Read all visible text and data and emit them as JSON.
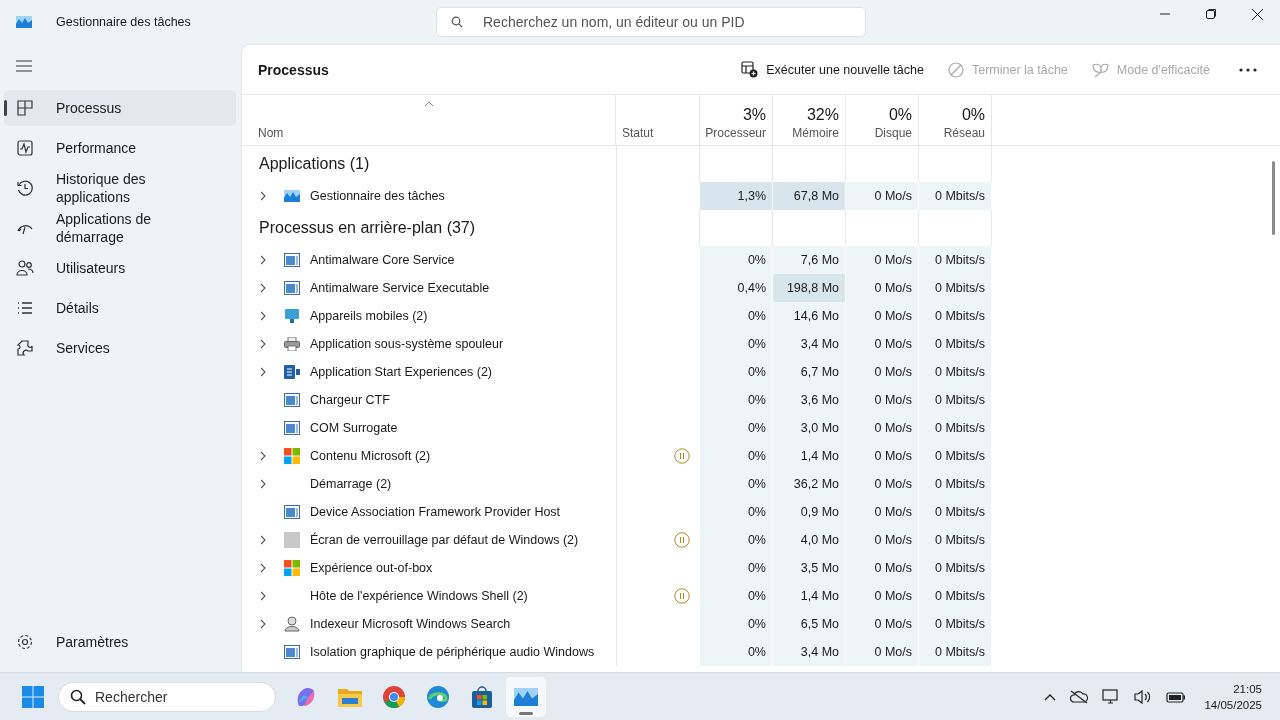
{
  "window": {
    "title": "Gestionnaire des tâches"
  },
  "search": {
    "placeholder": "Recherchez un nom, un éditeur ou un PID"
  },
  "sidebar": {
    "items": [
      {
        "label": "Processus",
        "selected": true
      },
      {
        "label": "Performance",
        "selected": false
      },
      {
        "label": "Historique des applications",
        "selected": false
      },
      {
        "label": "Applications de démarrage",
        "selected": false
      },
      {
        "label": "Utilisateurs",
        "selected": false
      },
      {
        "label": "Détails",
        "selected": false
      },
      {
        "label": "Services",
        "selected": false
      }
    ],
    "footer": {
      "label": "Paramètres"
    }
  },
  "page": {
    "title": "Processus",
    "actions": [
      {
        "label": "Exécuter une nouvelle tâche",
        "disabled": false
      },
      {
        "label": "Terminer la tâche",
        "disabled": true
      },
      {
        "label": "Mode d'efficacité",
        "disabled": true
      }
    ]
  },
  "table": {
    "columns": [
      {
        "label": "Nom",
        "sorted": true
      },
      {
        "label": "Statut",
        "sorted": false
      },
      {
        "label": "Processeur",
        "usage": "3%",
        "sorted": false
      },
      {
        "label": "Mémoire",
        "usage": "32%",
        "sorted": false
      },
      {
        "label": "Disque",
        "usage": "0%",
        "sorted": false
      },
      {
        "label": "Réseau",
        "usage": "0%",
        "sorted": false
      }
    ],
    "groups": [
      {
        "title": "Applications (1)",
        "rows": [
          {
            "name": "Gestionnaire des tâches",
            "kind": "taskmgr",
            "expandable": true,
            "suspended": false,
            "cpu": "1,3%",
            "memory": "67,8 Mo",
            "disk": "0 Mo/s",
            "network": "0 Mbits/s",
            "cpu_hot": true,
            "memory_hot": true
          }
        ]
      },
      {
        "title": "Processus en arrière-plan (37)",
        "rows": [
          {
            "name": "Antimalware Core Service",
            "kind": "service",
            "expandable": true,
            "suspended": false,
            "cpu": "0%",
            "memory": "7,6 Mo",
            "disk": "0 Mo/s",
            "network": "0 Mbits/s",
            "cpu_hot": false,
            "memory_hot": false
          },
          {
            "name": "Antimalware Service Executable",
            "kind": "service",
            "expandable": true,
            "suspended": false,
            "cpu": "0,4%",
            "memory": "198,8 Mo",
            "disk": "0 Mo/s",
            "network": "0 Mbits/s",
            "cpu_hot": false,
            "memory_hot": true
          },
          {
            "name": "Appareils mobiles (2)",
            "kind": "mobile",
            "expandable": true,
            "suspended": false,
            "cpu": "0%",
            "memory": "14,6 Mo",
            "disk": "0 Mo/s",
            "network": "0 Mbits/s",
            "cpu_hot": false,
            "memory_hot": false
          },
          {
            "name": "Application sous-système spouleur",
            "kind": "printer",
            "expandable": true,
            "suspended": false,
            "cpu": "0%",
            "memory": "3,4 Mo",
            "disk": "0 Mo/s",
            "network": "0 Mbits/s",
            "cpu_hot": false,
            "memory_hot": false
          },
          {
            "name": "Application Start Experiences (2)",
            "kind": "appstart",
            "expandable": true,
            "suspended": false,
            "cpu": "0%",
            "memory": "6,7 Mo",
            "disk": "0 Mo/s",
            "network": "0 Mbits/s",
            "cpu_hot": false,
            "memory_hot": false
          },
          {
            "name": "Chargeur CTF",
            "kind": "service",
            "expandable": false,
            "suspended": false,
            "cpu": "0%",
            "memory": "3,6 Mo",
            "disk": "0 Mo/s",
            "network": "0 Mbits/s",
            "cpu_hot": false,
            "memory_hot": false
          },
          {
            "name": "COM Surrogate",
            "kind": "service",
            "expandable": false,
            "suspended": false,
            "cpu": "0%",
            "memory": "3,0 Mo",
            "disk": "0 Mo/s",
            "network": "0 Mbits/s",
            "cpu_hot": false,
            "memory_hot": false
          },
          {
            "name": "Contenu Microsoft (2)",
            "kind": "tiles",
            "expandable": true,
            "suspended": true,
            "cpu": "0%",
            "memory": "1,4 Mo",
            "disk": "0 Mo/s",
            "network": "0 Mbits/s",
            "cpu_hot": false,
            "memory_hot": false
          },
          {
            "name": "Démarrage (2)",
            "kind": "none",
            "expandable": true,
            "suspended": false,
            "cpu": "0%",
            "memory": "36,2 Mo",
            "disk": "0 Mo/s",
            "network": "0 Mbits/s",
            "cpu_hot": false,
            "memory_hot": false
          },
          {
            "name": "Device Association Framework Provider Host",
            "kind": "service",
            "expandable": false,
            "suspended": false,
            "cpu": "0%",
            "memory": "0,9 Mo",
            "disk": "0 Mo/s",
            "network": "0 Mbits/s",
            "cpu_hot": false,
            "memory_hot": false
          },
          {
            "name": "Écran de verrouillage par défaut de Windows (2)",
            "kind": "lockscreen",
            "expandable": true,
            "suspended": true,
            "cpu": "0%",
            "memory": "4,0 Mo",
            "disk": "0 Mo/s",
            "network": "0 Mbits/s",
            "cpu_hot": false,
            "memory_hot": false
          },
          {
            "name": "Expérience out-of-box",
            "kind": "tiles",
            "expandable": true,
            "suspended": false,
            "cpu": "0%",
            "memory": "3,5 Mo",
            "disk": "0 Mo/s",
            "network": "0 Mbits/s",
            "cpu_hot": false,
            "memory_hot": false
          },
          {
            "name": "Hôte de l'expérience Windows Shell (2)",
            "kind": "none",
            "expandable": true,
            "suspended": true,
            "cpu": "0%",
            "memory": "1,4 Mo",
            "disk": "0 Mo/s",
            "network": "0 Mbits/s",
            "cpu_hot": false,
            "memory_hot": false
          },
          {
            "name": "Indexeur Microsoft Windows Search",
            "kind": "indexer",
            "expandable": true,
            "suspended": false,
            "cpu": "0%",
            "memory": "6,5 Mo",
            "disk": "0 Mo/s",
            "network": "0 Mbits/s",
            "cpu_hot": false,
            "memory_hot": false
          },
          {
            "name": "Isolation graphique de périphérique audio Windows",
            "kind": "service",
            "expandable": false,
            "suspended": false,
            "cpu": "0%",
            "memory": "3,4 Mo",
            "disk": "0 Mo/s",
            "network": "0 Mbits/s",
            "cpu_hot": false,
            "memory_hot": false
          }
        ]
      }
    ]
  },
  "taskbar": {
    "search_placeholder": "Rechercher",
    "apps": [
      {
        "kind": "copilot",
        "active": false
      },
      {
        "kind": "folder",
        "active": false
      },
      {
        "kind": "chrome",
        "active": false
      },
      {
        "kind": "edge",
        "active": false
      },
      {
        "kind": "store",
        "active": false
      },
      {
        "kind": "taskmgr",
        "active": true
      }
    ],
    "time": "21:05",
    "date": "14/05/2025"
  }
}
